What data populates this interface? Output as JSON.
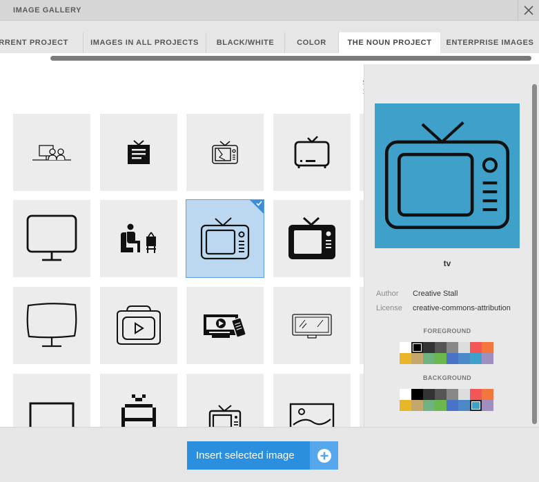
{
  "header": {
    "title": "IMAGE GALLERY"
  },
  "tabs": [
    {
      "label": "CURRENT PROJECT",
      "active": false
    },
    {
      "label": "IMAGES IN ALL PROJECTS",
      "active": false
    },
    {
      "label": "BLACK/WHITE",
      "active": false
    },
    {
      "label": "COLOR",
      "active": false
    },
    {
      "label": "THE NOUN PROJECT",
      "active": true
    },
    {
      "label": "ENTERPRISE IMAGES",
      "active": false
    }
  ],
  "grid": {
    "partial_text_top": "S",
    "partial_text_bottom": "1",
    "tiles": [
      {
        "icon": "people-at-desk-icon"
      },
      {
        "icon": "tv-list-icon"
      },
      {
        "icon": "broken-tv-icon"
      },
      {
        "icon": "retro-tv-icon"
      },
      {
        "icon": "monitor-icon"
      },
      {
        "icon": "person-watching-tv-icon"
      },
      {
        "icon": "tv-icon",
        "selected": true
      },
      {
        "icon": "black-tv-icon"
      },
      {
        "icon": "sketch-monitor-icon"
      },
      {
        "icon": "video-tv-icon"
      },
      {
        "icon": "tv-remote-icon"
      },
      {
        "icon": "flat-tv-icon"
      },
      {
        "icon": "widescreen-tv-icon"
      },
      {
        "icon": "pixel-tv-icon"
      },
      {
        "icon": "small-tv-icon"
      },
      {
        "icon": "picture-frame-icon"
      }
    ]
  },
  "details": {
    "name": "tv",
    "author_label": "Author",
    "author": "Creative Stall",
    "license_label": "License",
    "license": "creative-commons-attribution",
    "foreground_label": "FOREGROUND",
    "background_label": "BACKGROUND",
    "preview_bg": "#3fa0c9",
    "palette": [
      "#ffffff",
      "#000000",
      "#333333",
      "#555555",
      "#888888",
      "#dddddd",
      "#f25656",
      "#f3763e",
      "#e8b52a",
      "#c4a76a",
      "#6fb480",
      "#6cb84e",
      "#4a73c8",
      "#4a88c8",
      "#3fa0c9",
      "#9e8fbf"
    ],
    "foreground_selected": 1,
    "background_selected": 14
  },
  "footer": {
    "insert_label": "Insert selected image"
  }
}
